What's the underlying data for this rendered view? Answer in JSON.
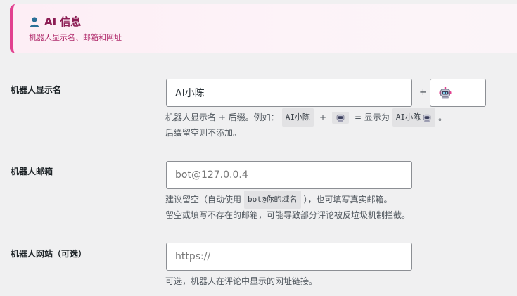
{
  "header": {
    "title": "AI 信息",
    "subtitle": "机器人显示名、邮箱和网址",
    "icon": "user-icon"
  },
  "display_name": {
    "label": "机器人显示名",
    "value": "AI小陈",
    "plus": "+",
    "suffix_icon": "robot-icon",
    "help": {
      "line1_before": "机器人显示名 + 后缀。例如：",
      "example_name": "AI小陈",
      "plus": "+",
      "equals": "= 显示为",
      "example_result": "AI小陈",
      "period": "。",
      "line2": "后缀留空则不添加。"
    }
  },
  "email": {
    "label": "机器人邮箱",
    "placeholder": "bot@127.0.0.4",
    "help": {
      "line1_before": "建议留空（自动使用",
      "code": "bot@你的域名",
      "line1_after": "），也可填写真实邮箱。",
      "line2": "留空或填写不存在的邮箱，可能导致部分评论被反垃圾机制拦截。"
    }
  },
  "website": {
    "label": "机器人网站（可选）",
    "placeholder": "https://",
    "help": "可选，机器人在评论中显示的网址链接。"
  },
  "colors": {
    "accent": "#e2408f",
    "title": "#8c1d54",
    "subtitle": "#b02a6b"
  }
}
